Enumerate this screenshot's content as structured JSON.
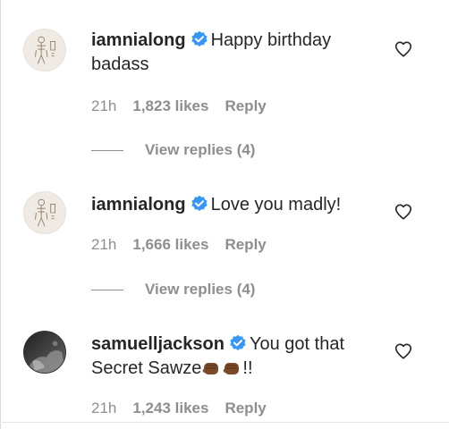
{
  "comments": [
    {
      "username": "iamnialong",
      "verified": true,
      "text": "Happy birthday badass",
      "time": "21h",
      "likes": "1,823 likes",
      "reply": "Reply",
      "view_replies": "View replies (4)",
      "avatar": "sketch-avatar"
    },
    {
      "username": "iamnialong",
      "verified": true,
      "text": "Love you madly!",
      "time": "21h",
      "likes": "1,666 likes",
      "reply": "Reply",
      "view_replies": "View replies (4)",
      "avatar": "sketch-avatar"
    },
    {
      "username": "samuelljackson",
      "verified": true,
      "text": "You got that Secret Sawze",
      "text_suffix": "!!",
      "emojis": [
        "fist-emoji",
        "fist-emoji"
      ],
      "time": "21h",
      "likes": "1,243 likes",
      "reply": "Reply",
      "avatar": "photo-avatar"
    }
  ],
  "colors": {
    "verified_blue": "#3897f0",
    "meta_gray": "#8e8e8e",
    "text": "#262626"
  }
}
